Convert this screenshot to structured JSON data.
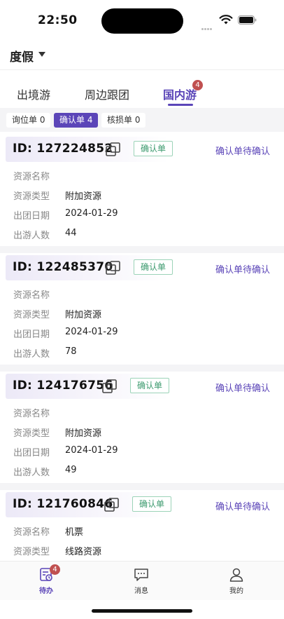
{
  "status_bar": {
    "time": "22:50"
  },
  "header": {
    "title": "度假"
  },
  "main_tabs": [
    {
      "label": "出境游",
      "active": false
    },
    {
      "label": "周边跟团",
      "active": false
    },
    {
      "label": "国内游",
      "active": true,
      "badge": "4"
    }
  ],
  "sub_tabs": [
    {
      "label": "询位单 0",
      "active": false
    },
    {
      "label": "确认单 4",
      "active": true
    },
    {
      "label": "核损单 0",
      "active": false
    }
  ],
  "field_labels": {
    "resource_name": "资源名称",
    "resource_type": "资源类型",
    "departure_date": "出团日期",
    "travelers": "出游人数"
  },
  "orders": [
    {
      "id": "ID: 127224852",
      "badge": "确认单",
      "status": "确认单待确认",
      "resource_name": "",
      "resource_type": "附加资源",
      "departure_date": "2024-01-29",
      "travelers": "44"
    },
    {
      "id": "ID: 122485370",
      "badge": "确认单",
      "status": "确认单待确认",
      "resource_name": "",
      "resource_type": "附加资源",
      "departure_date": "2024-01-29",
      "travelers": "78"
    },
    {
      "id": "ID: 124176756",
      "badge": "确认单",
      "status": "确认单待确认",
      "resource_name": "",
      "resource_type": "附加资源",
      "departure_date": "2024-01-29",
      "travelers": "49"
    },
    {
      "id": "ID: 121760846",
      "badge": "确认单",
      "status": "确认单待确认",
      "resource_name": "机票",
      "resource_type": "线路资源",
      "departure_date": "",
      "travelers": ""
    }
  ],
  "bottom_nav": [
    {
      "label": "待办",
      "icon": "todo-icon",
      "active": true,
      "badge": "4"
    },
    {
      "label": "消息",
      "icon": "message-icon",
      "active": false
    },
    {
      "label": "我的",
      "icon": "profile-icon",
      "active": false
    }
  ],
  "colors": {
    "accent": "#5b45b8",
    "badge_red": "#c05050",
    "confirm_green": "#3c9a6e"
  }
}
